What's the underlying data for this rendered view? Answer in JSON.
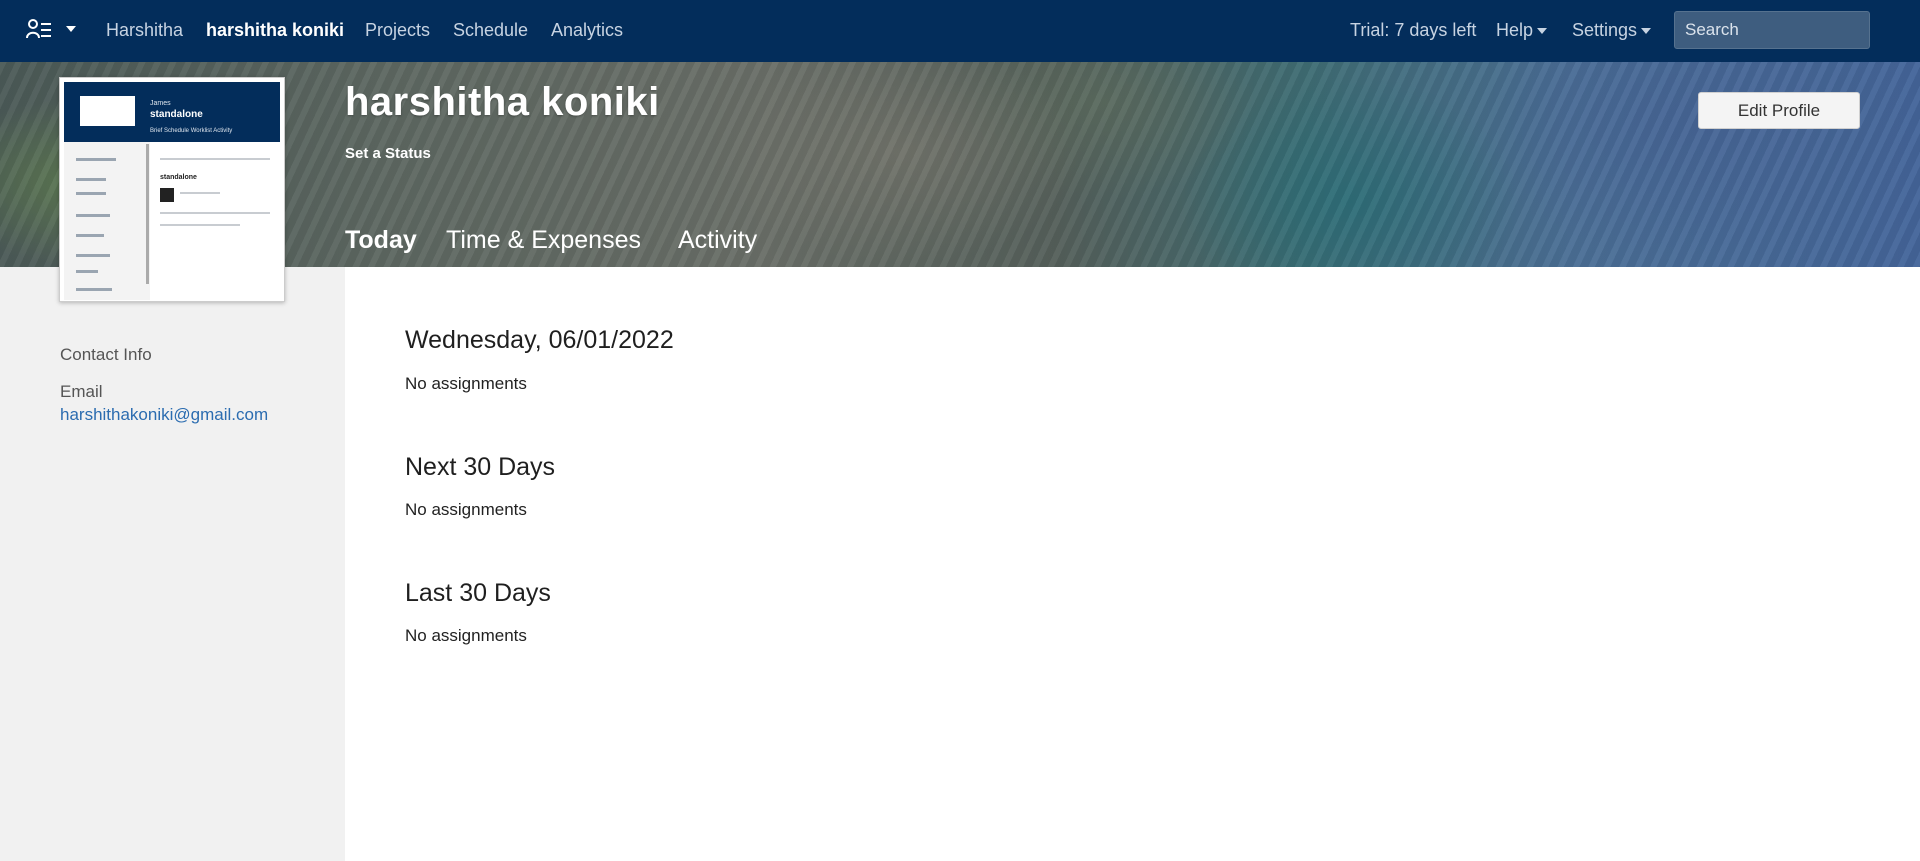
{
  "nav": {
    "links": [
      "Harshitha",
      "harshitha koniki",
      "Projects",
      "Schedule",
      "Analytics"
    ],
    "trial": "Trial: 7 days left",
    "help": "Help",
    "settings": "Settings",
    "search_placeholder": "Search"
  },
  "profile": {
    "name": "harshitha koniki",
    "set_status": "Set a Status",
    "edit_profile": "Edit Profile",
    "tabs": [
      "Today",
      "Time & Expenses",
      "Activity"
    ]
  },
  "thumbnail": {
    "user": "James",
    "name": "standalone",
    "tabs": "Brief   Schedule   Worklist   Activity",
    "section": "standalone"
  },
  "contact": {
    "title": "Contact Info",
    "email_label": "Email",
    "email": "harshithakoniki@gmail.com"
  },
  "sections": [
    {
      "title": "Wednesday, 06/01/2022",
      "body": "No assignments"
    },
    {
      "title": "Next 30 Days",
      "body": "No assignments"
    },
    {
      "title": "Last 30 Days",
      "body": "No assignments"
    }
  ],
  "colors": {
    "nav_bg": "#032d5b",
    "link": "#2b6cb0"
  }
}
